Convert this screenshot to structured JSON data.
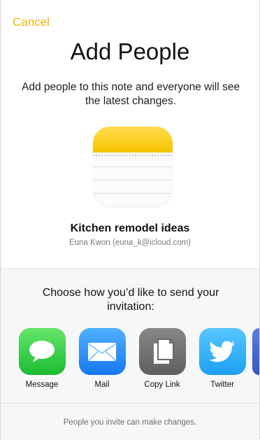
{
  "header": {
    "cancel_label": "Cancel",
    "title": "Add People",
    "subtitle": "Add people to this note and everyone will see the latest changes."
  },
  "note": {
    "title": "Kitchen remodel ideas",
    "owner": "Euna Kwon (euna_k@icloud.com)"
  },
  "share": {
    "prompt": "Choose how you’d like to send your invitation:",
    "apps": [
      {
        "label": "Message",
        "icon": "message-icon"
      },
      {
        "label": "Mail",
        "icon": "mail-icon"
      },
      {
        "label": "Copy Link",
        "icon": "copy-link-icon"
      },
      {
        "label": "Twitter",
        "icon": "twitter-icon"
      }
    ]
  },
  "footer": {
    "text": "People you invite can make changes."
  },
  "colors": {
    "accent": "#f2b400",
    "message_green": "#20c43b",
    "mail_blue": "#1b84ff",
    "copy_gray": "#6f6f6f",
    "twitter_blue": "#1da1f2",
    "notes_yellow": "#f6c500"
  }
}
